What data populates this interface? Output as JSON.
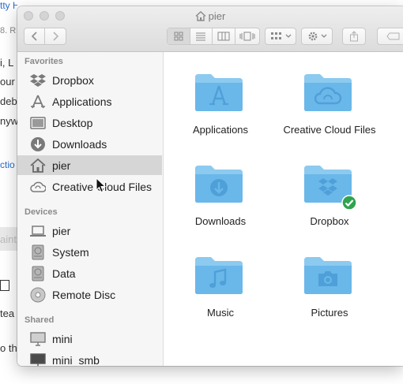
{
  "background": {
    "fragments": [
      "tty Heuzenbeer",
      "8. R",
      "i, L",
      "our",
      "deb",
      "nyw",
      "ctio",
      "aint",
      "tea",
      "o th"
    ]
  },
  "window": {
    "title": "pier"
  },
  "toolbar": {
    "back_icon": "chevron-left-icon",
    "forward_icon": "chevron-right-icon",
    "view_modes": [
      "icon-view",
      "list-view",
      "column-view",
      "cover-flow-view"
    ],
    "arrange_icon": "arrange-grid-icon",
    "action_icon": "gear-icon",
    "share_icon": "share-icon",
    "tags_icon": "tag-icon"
  },
  "sidebar": {
    "favorites_header": "Favorites",
    "favorites": [
      {
        "label": "Dropbox",
        "icon": "dropbox-icon"
      },
      {
        "label": "Applications",
        "icon": "applications-icon"
      },
      {
        "label": "Desktop",
        "icon": "desktop-icon"
      },
      {
        "label": "Downloads",
        "icon": "downloads-icon"
      },
      {
        "label": "pier",
        "icon": "home-icon",
        "selected": true
      },
      {
        "label": "Creative Cloud Files",
        "icon": "creative-cloud-icon"
      }
    ],
    "devices_header": "Devices",
    "devices": [
      {
        "label": "pier",
        "icon": "laptop-icon"
      },
      {
        "label": "System",
        "icon": "disk-icon"
      },
      {
        "label": "Data",
        "icon": "disk-icon"
      },
      {
        "label": "Remote Disc",
        "icon": "optical-disc-icon"
      }
    ],
    "shared_header": "Shared",
    "shared": [
      {
        "label": "mini",
        "icon": "display-icon"
      },
      {
        "label": "mini_smb",
        "icon": "display-icon"
      }
    ]
  },
  "content": {
    "items": [
      {
        "label": "Applications",
        "icon": "applications-folder-icon"
      },
      {
        "label": "Creative Cloud Files",
        "icon": "creative-cloud-folder-icon"
      },
      {
        "label": "Downloads",
        "icon": "downloads-folder-icon"
      },
      {
        "label": "Dropbox",
        "icon": "dropbox-folder-icon",
        "synced": true
      },
      {
        "label": "Music",
        "icon": "music-folder-icon"
      },
      {
        "label": "Pictures",
        "icon": "pictures-folder-icon"
      }
    ]
  },
  "colors": {
    "folder": "#6ab7ea",
    "folder_glyph": "#4f9fd8",
    "selection": "#d6d6d6",
    "sync_badge": "#2ea44f"
  }
}
